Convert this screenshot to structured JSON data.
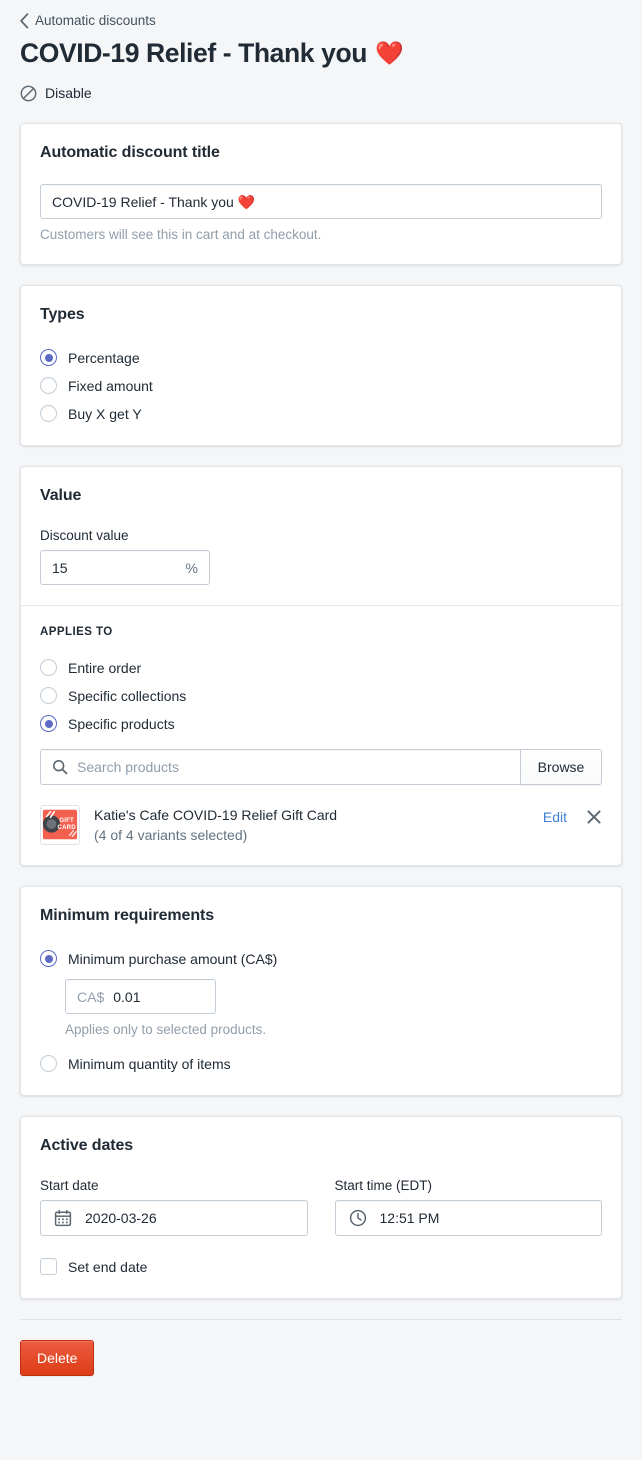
{
  "header": {
    "breadcrumb": "Automatic discounts",
    "breadcrumb_icon": "chevron-left-icon",
    "title": "COVID-19 Relief - Thank you",
    "title_emoji": "❤️",
    "disable_label": "Disable",
    "disable_icon": "disable-circle-slash-icon"
  },
  "title_card": {
    "heading": "Automatic discount title",
    "input_value": "COVID-19 Relief - Thank you ❤️",
    "input_placeholder": "",
    "help_text": "Customers will see this in cart and at checkout."
  },
  "types_card": {
    "heading": "Types",
    "options": [
      {
        "label": "Percentage",
        "selected": true
      },
      {
        "label": "Fixed amount",
        "selected": false
      },
      {
        "label": "Buy X get Y",
        "selected": false
      }
    ]
  },
  "value_card": {
    "heading": "Value",
    "field_label": "Discount value",
    "value": "15",
    "suffix": "%",
    "applies_to": {
      "sub_heading": "APPLIES TO",
      "options": [
        {
          "label": "Entire order",
          "selected": false
        },
        {
          "label": "Specific collections",
          "selected": false
        },
        {
          "label": "Specific products",
          "selected": true
        }
      ],
      "search_placeholder": "Search products",
      "search_value": "",
      "search_icon": "search-icon",
      "browse_label": "Browse",
      "products": [
        {
          "name": "Katie's Cafe COVID-19 Relief Gift Card",
          "variants": "(4 of 4 variants selected)",
          "thumbnail_label": "GIFT CARD",
          "thumbnail_color": "#f4604f",
          "edit_label": "Edit",
          "remove_icon": "close-icon"
        }
      ]
    }
  },
  "minimum_card": {
    "heading": "Minimum requirements",
    "options": [
      {
        "label": "Minimum purchase amount (CA$)",
        "selected": true
      },
      {
        "label": "Minimum quantity of items",
        "selected": false
      }
    ],
    "amount_prefix": "CA$",
    "amount_value": "0.01",
    "help_text": "Applies only to selected products."
  },
  "dates_card": {
    "heading": "Active dates",
    "start_date_label": "Start date",
    "start_date_value": "2020-03-26",
    "start_date_icon": "calendar-icon",
    "start_time_label": "Start time (EDT)",
    "start_time_value": "12:51 PM",
    "start_time_icon": "clock-icon",
    "end_date_checkbox_label": "Set end date",
    "end_date_checked": false
  },
  "footer": {
    "delete_label": "Delete",
    "delete_color": "#dd3d17"
  }
}
